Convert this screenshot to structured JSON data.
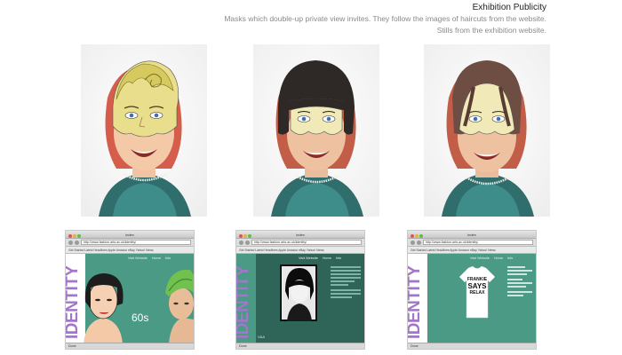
{
  "header": {
    "title": "Exhibition Publicity",
    "line1": "Masks which double-up private view invites. They follow the images of haircuts from the website.",
    "line2": "Stills from  the exhibition website."
  },
  "photos": [
    {
      "name": "mask-blonde-quiff",
      "hair": "#d8cc6a"
    },
    {
      "name": "mask-black-bob",
      "hair": "#2e2926"
    },
    {
      "name": "mask-long-brown",
      "hair": "#6e4e43"
    }
  ],
  "browser": {
    "window_title": "index",
    "url": "http://www.fashion.arts.ac.uk/identity/",
    "bookmarks": "Get Started   Latest Headlines   Apple   Amazon   eBay   Yahoo!   News",
    "status": "Done"
  },
  "site": {
    "id_word": "IDENTITY",
    "id_sub": "the history of British Tribal fashion",
    "menu": [
      "Visit Website",
      "Home",
      "Info"
    ],
    "decade_label": "60s",
    "tshirt_text": [
      "FRANKIE",
      "SAYS",
      "RELAX"
    ],
    "va": "V&A"
  },
  "colors": {
    "teal": "#4a9a86",
    "dark_teal": "#2f6558",
    "purple": "#a276c8",
    "skin": "#f3c9a8"
  }
}
